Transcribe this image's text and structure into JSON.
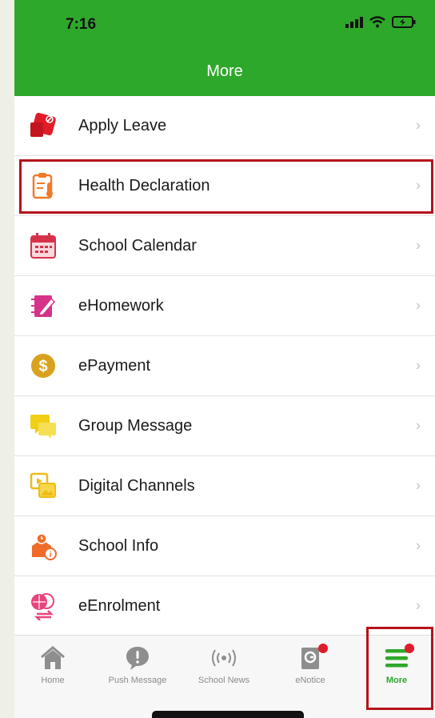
{
  "status_bar": {
    "time": "7:16"
  },
  "header": {
    "title": "More"
  },
  "menu": [
    {
      "label": "Apply Leave",
      "icon": "apply-leave-icon"
    },
    {
      "label": "Health Declaration",
      "icon": "health-declaration-icon",
      "highlighted": true
    },
    {
      "label": "School Calendar",
      "icon": "calendar-icon"
    },
    {
      "label": "eHomework",
      "icon": "homework-icon"
    },
    {
      "label": "ePayment",
      "icon": "payment-icon"
    },
    {
      "label": "Group Message",
      "icon": "group-message-icon"
    },
    {
      "label": "Digital Channels",
      "icon": "digital-channels-icon"
    },
    {
      "label": "School Info",
      "icon": "school-info-icon"
    },
    {
      "label": "eEnrolment",
      "icon": "enrolment-icon"
    }
  ],
  "chevron": "›",
  "tabs": [
    {
      "label": "Home",
      "icon": "home-icon"
    },
    {
      "label": "Push Message",
      "icon": "push-message-icon"
    },
    {
      "label": "School News",
      "icon": "broadcast-icon"
    },
    {
      "label": "eNotice",
      "icon": "notice-icon",
      "badge": true
    },
    {
      "label": "More",
      "icon": "more-menu-icon",
      "active": true,
      "badge": true
    }
  ],
  "colors": {
    "brand_green": "#2ea82a",
    "highlight_red": "#b5121b",
    "badge_red": "#e01b2a"
  }
}
